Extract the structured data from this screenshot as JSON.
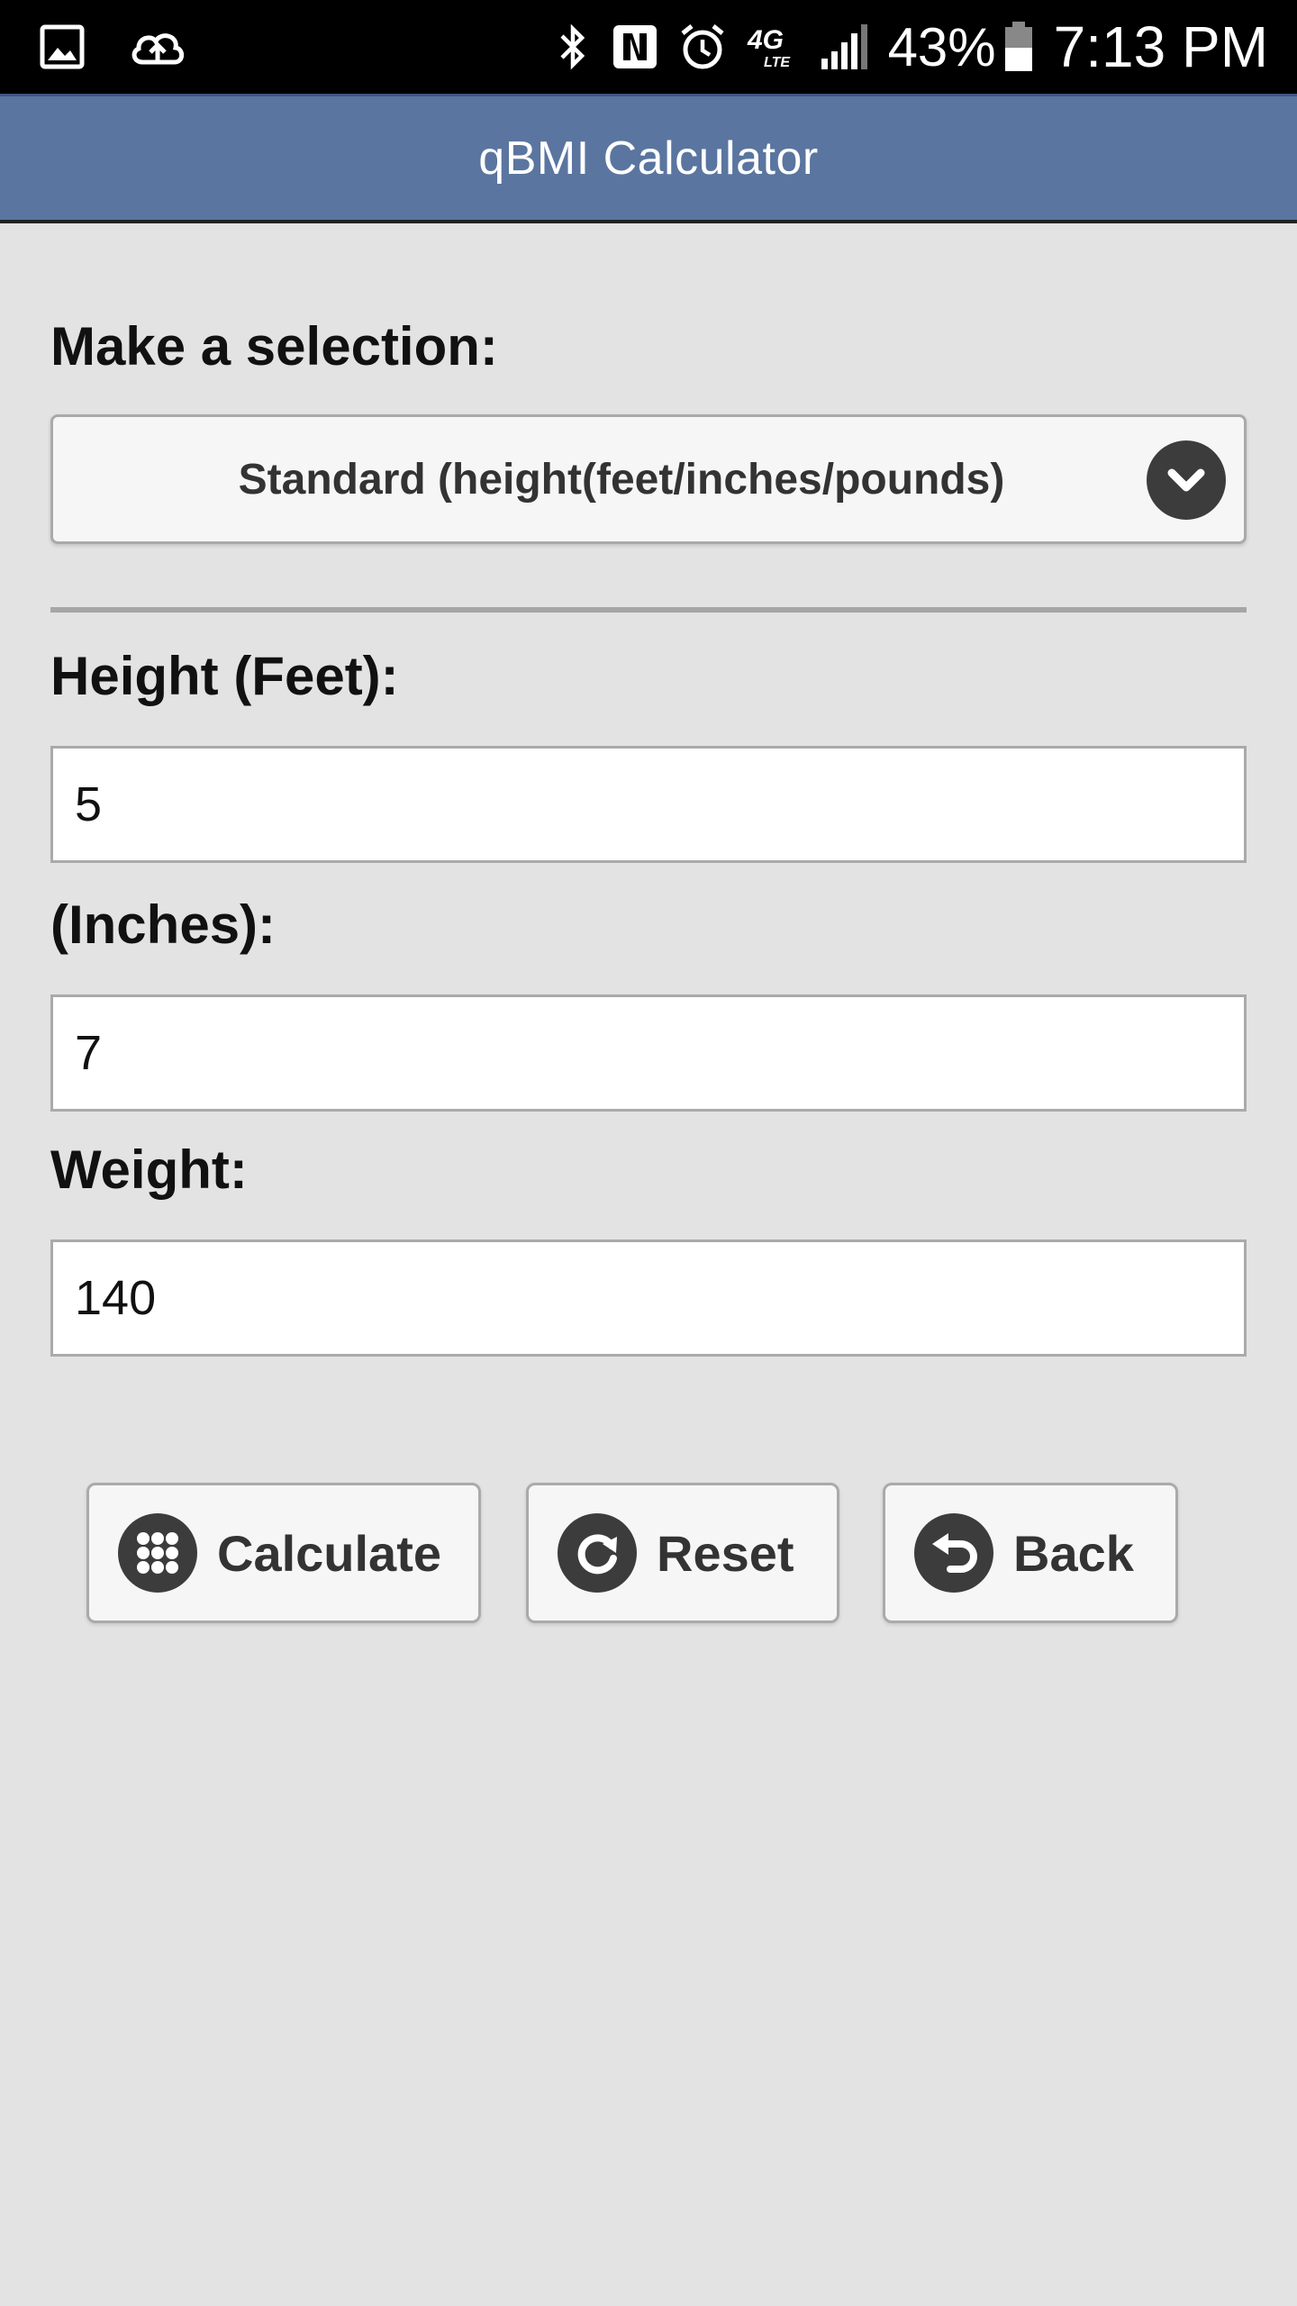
{
  "status_bar": {
    "left_icons": [
      "gallery-icon",
      "cloud-upload-icon"
    ],
    "right_icons": [
      "bluetooth-icon",
      "nfc-icon",
      "alarm-icon",
      "network-4g-lte-icon",
      "signal-icon"
    ],
    "battery": "43%",
    "time": "7:13 PM"
  },
  "app_bar": {
    "title": "qBMI Calculator"
  },
  "form": {
    "selection_label": "Make a selection:",
    "selection_value": "Standard (height(feet/inches/pounds)",
    "height_feet_label": "Height (Feet):",
    "height_feet_value": "5",
    "inches_label": "(Inches):",
    "inches_value": "7",
    "weight_label": "Weight:",
    "weight_value": "140"
  },
  "buttons": {
    "calculate": "Calculate",
    "reset": "Reset",
    "back": "Back"
  },
  "colors": {
    "app_bar": "#5a759f",
    "background": "#e3e3e3",
    "icon_circle": "#3c3c3c"
  }
}
